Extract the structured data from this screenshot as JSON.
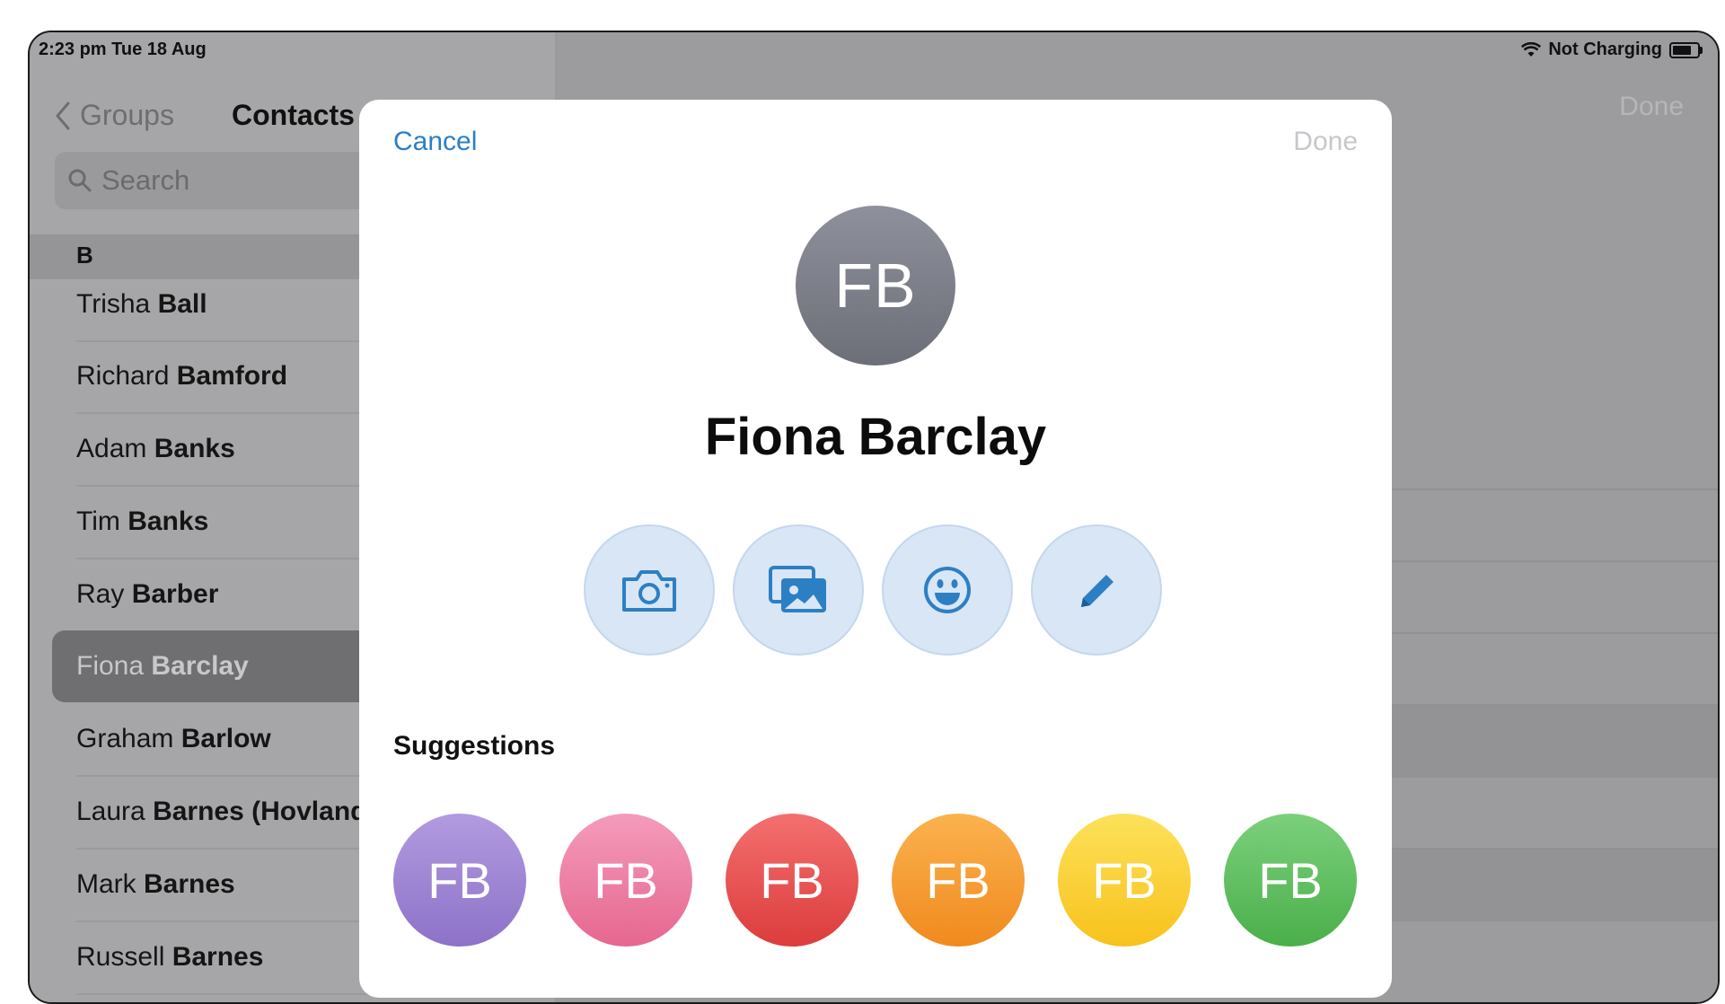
{
  "status": {
    "time": "2:23 pm  Tue 18 Aug",
    "charging": "Not Charging"
  },
  "sidebar": {
    "back_label": "Groups",
    "title": "Contacts",
    "search_placeholder": "Search",
    "section": "B",
    "contacts": [
      {
        "first": "Trisha ",
        "last": "Ball"
      },
      {
        "first": "Richard ",
        "last": "Bamford"
      },
      {
        "first": "Adam ",
        "last": "Banks"
      },
      {
        "first": "Tim ",
        "last": "Banks"
      },
      {
        "first": "Ray ",
        "last": "Barber"
      },
      {
        "first": "Fiona ",
        "last": "Barclay"
      },
      {
        "first": "Graham ",
        "last": "Barlow"
      },
      {
        "first": "Laura ",
        "last": "Barnes (Hovland)"
      },
      {
        "first": "Mark ",
        "last": "Barnes"
      },
      {
        "first": "Russell ",
        "last": "Barnes"
      }
    ]
  },
  "detail": {
    "done_label": "Done"
  },
  "modal": {
    "cancel_label": "Cancel",
    "done_label": "Done",
    "initials": "FB",
    "name": "Fiona Barclay",
    "actions": [
      "camera-icon",
      "photos-icon",
      "emoji-icon",
      "pencil-icon"
    ],
    "suggestions_title": "Suggestions",
    "suggestions": [
      {
        "initials": "FB",
        "color_top": "#b29be0",
        "color_bottom": "#8d72c8"
      },
      {
        "initials": "FB",
        "color_top": "#f49bbb",
        "color_bottom": "#e6678f"
      },
      {
        "initials": "FB",
        "color_top": "#f3706f",
        "color_bottom": "#dd3c3c"
      },
      {
        "initials": "FB",
        "color_top": "#fbb24e",
        "color_bottom": "#f08a1e"
      },
      {
        "initials": "FB",
        "color_top": "#fde15a",
        "color_bottom": "#f8c21c"
      },
      {
        "initials": "FB",
        "color_top": "#7cd07c",
        "color_bottom": "#4aaf4a"
      }
    ]
  },
  "colors": {
    "accent": "#2d7fc4"
  }
}
